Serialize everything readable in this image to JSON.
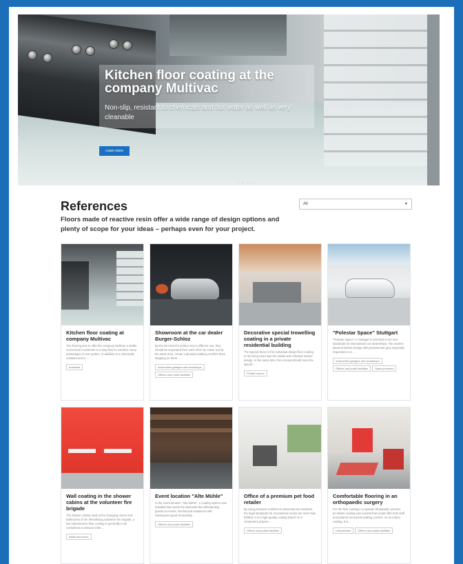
{
  "hero": {
    "title": "Kitchen floor coating at the company Multivac",
    "subtitle": "Non-slip, resistant to chemicals and hot water as well as very cleanable",
    "button": "Learn more",
    "slides": 4
  },
  "references": {
    "title": "References",
    "intro": "Floors made of reactive resin offer a wide range of design options and plenty of scope for your ideas – perhaps even for your project.",
    "filter_value": "All"
  },
  "cards": [
    {
      "title": "Kitchen floor coating at company Multivac",
      "text": "The flooring was to offer the company Multivac a stable, economical investment in a long floor to combine many advantages in one system. In addition to a chemically resistant and si…",
      "tags": [
        "Industrial"
      ]
    },
    {
      "title": "Showroom at the car dealer Burger-Schloz",
      "text": "By the fact that the surface has a different use, they should be separated from each other by colour and at the same time, create a pleasant walking comfort when stepping on them…",
      "tags": [
        "Automotive garages and workshops",
        "Offices and public facilities"
      ]
    },
    {
      "title": "Decorative special trowelling coating in a private residential building",
      "text": "The special focus in this individual design floor coating in the living room was the visible and cohesive interior design. At the same time, the concept should meet the specifi…",
      "tags": [
        "Private homes"
      ]
    },
    {
      "title": "\"Polestar Space\" Stuttgart",
      "text": "\"Polestar Space\" in Stuttgart is intended to set new standards for international car dealerships. The modern planned interior design with predominant grey especially requested a ne…",
      "tags": [
        "Automotive garages and workshops",
        "Offices and public facilities",
        "Sales premises"
      ]
    },
    {
      "title": "Wall coating in the shower cabins at the volunteer fire brigade",
      "text": "The shower cabins used at the changing rooms and bathrooms of the Stendsburg volunteer fire brigade, a low maintenance floor coating is generally to be considered a relevant criter…",
      "tags": [
        "Walls and doors"
      ]
    },
    {
      "title": "Event location \"Alte Mühle\"",
      "text": "In the event location \"Alte Mühle\", a coating system was installed that meets the demands like withstanding guests at events, mechanical resistance with subsequent good cleanability.",
      "tags": [
        "Offices and public facilities"
      ]
    },
    {
      "title": "Office of a premium pet food retailer",
      "text": "By using products certified as extremely low emission, the legal standards for recreational rooms are more than fulfilled. It is a high-quality coating based on 2-component polyure…",
      "tags": [
        "Offices and public facilities"
      ]
    },
    {
      "title": "Comfortable flooring in an orthopaedic surgery",
      "text": "For the floor coating in a special orthopaedic practice, an elastic coating was needed that would offer both staff and patients increased walking comfort. As an indoor coating, it w…",
      "tags": [
        "Laboratories",
        "Offices and public facilities"
      ]
    }
  ]
}
